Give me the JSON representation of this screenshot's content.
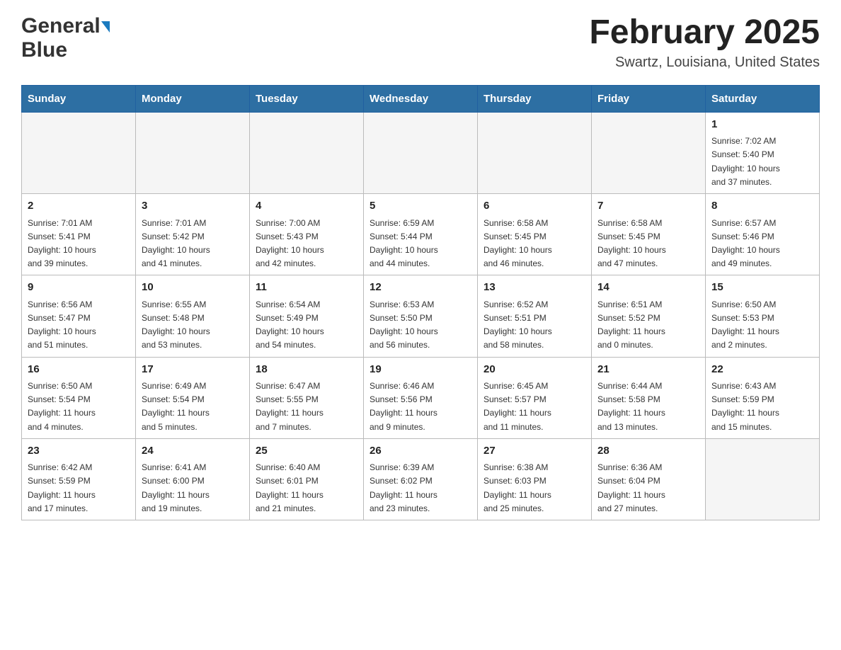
{
  "header": {
    "logo_general": "General",
    "logo_blue": "Blue",
    "month_year": "February 2025",
    "location": "Swartz, Louisiana, United States"
  },
  "weekdays": [
    "Sunday",
    "Monday",
    "Tuesday",
    "Wednesday",
    "Thursday",
    "Friday",
    "Saturday"
  ],
  "weeks": [
    [
      {
        "day": "",
        "info": ""
      },
      {
        "day": "",
        "info": ""
      },
      {
        "day": "",
        "info": ""
      },
      {
        "day": "",
        "info": ""
      },
      {
        "day": "",
        "info": ""
      },
      {
        "day": "",
        "info": ""
      },
      {
        "day": "1",
        "info": "Sunrise: 7:02 AM\nSunset: 5:40 PM\nDaylight: 10 hours\nand 37 minutes."
      }
    ],
    [
      {
        "day": "2",
        "info": "Sunrise: 7:01 AM\nSunset: 5:41 PM\nDaylight: 10 hours\nand 39 minutes."
      },
      {
        "day": "3",
        "info": "Sunrise: 7:01 AM\nSunset: 5:42 PM\nDaylight: 10 hours\nand 41 minutes."
      },
      {
        "day": "4",
        "info": "Sunrise: 7:00 AM\nSunset: 5:43 PM\nDaylight: 10 hours\nand 42 minutes."
      },
      {
        "day": "5",
        "info": "Sunrise: 6:59 AM\nSunset: 5:44 PM\nDaylight: 10 hours\nand 44 minutes."
      },
      {
        "day": "6",
        "info": "Sunrise: 6:58 AM\nSunset: 5:45 PM\nDaylight: 10 hours\nand 46 minutes."
      },
      {
        "day": "7",
        "info": "Sunrise: 6:58 AM\nSunset: 5:45 PM\nDaylight: 10 hours\nand 47 minutes."
      },
      {
        "day": "8",
        "info": "Sunrise: 6:57 AM\nSunset: 5:46 PM\nDaylight: 10 hours\nand 49 minutes."
      }
    ],
    [
      {
        "day": "9",
        "info": "Sunrise: 6:56 AM\nSunset: 5:47 PM\nDaylight: 10 hours\nand 51 minutes."
      },
      {
        "day": "10",
        "info": "Sunrise: 6:55 AM\nSunset: 5:48 PM\nDaylight: 10 hours\nand 53 minutes."
      },
      {
        "day": "11",
        "info": "Sunrise: 6:54 AM\nSunset: 5:49 PM\nDaylight: 10 hours\nand 54 minutes."
      },
      {
        "day": "12",
        "info": "Sunrise: 6:53 AM\nSunset: 5:50 PM\nDaylight: 10 hours\nand 56 minutes."
      },
      {
        "day": "13",
        "info": "Sunrise: 6:52 AM\nSunset: 5:51 PM\nDaylight: 10 hours\nand 58 minutes."
      },
      {
        "day": "14",
        "info": "Sunrise: 6:51 AM\nSunset: 5:52 PM\nDaylight: 11 hours\nand 0 minutes."
      },
      {
        "day": "15",
        "info": "Sunrise: 6:50 AM\nSunset: 5:53 PM\nDaylight: 11 hours\nand 2 minutes."
      }
    ],
    [
      {
        "day": "16",
        "info": "Sunrise: 6:50 AM\nSunset: 5:54 PM\nDaylight: 11 hours\nand 4 minutes."
      },
      {
        "day": "17",
        "info": "Sunrise: 6:49 AM\nSunset: 5:54 PM\nDaylight: 11 hours\nand 5 minutes."
      },
      {
        "day": "18",
        "info": "Sunrise: 6:47 AM\nSunset: 5:55 PM\nDaylight: 11 hours\nand 7 minutes."
      },
      {
        "day": "19",
        "info": "Sunrise: 6:46 AM\nSunset: 5:56 PM\nDaylight: 11 hours\nand 9 minutes."
      },
      {
        "day": "20",
        "info": "Sunrise: 6:45 AM\nSunset: 5:57 PM\nDaylight: 11 hours\nand 11 minutes."
      },
      {
        "day": "21",
        "info": "Sunrise: 6:44 AM\nSunset: 5:58 PM\nDaylight: 11 hours\nand 13 minutes."
      },
      {
        "day": "22",
        "info": "Sunrise: 6:43 AM\nSunset: 5:59 PM\nDaylight: 11 hours\nand 15 minutes."
      }
    ],
    [
      {
        "day": "23",
        "info": "Sunrise: 6:42 AM\nSunset: 5:59 PM\nDaylight: 11 hours\nand 17 minutes."
      },
      {
        "day": "24",
        "info": "Sunrise: 6:41 AM\nSunset: 6:00 PM\nDaylight: 11 hours\nand 19 minutes."
      },
      {
        "day": "25",
        "info": "Sunrise: 6:40 AM\nSunset: 6:01 PM\nDaylight: 11 hours\nand 21 minutes."
      },
      {
        "day": "26",
        "info": "Sunrise: 6:39 AM\nSunset: 6:02 PM\nDaylight: 11 hours\nand 23 minutes."
      },
      {
        "day": "27",
        "info": "Sunrise: 6:38 AM\nSunset: 6:03 PM\nDaylight: 11 hours\nand 25 minutes."
      },
      {
        "day": "28",
        "info": "Sunrise: 6:36 AM\nSunset: 6:04 PM\nDaylight: 11 hours\nand 27 minutes."
      },
      {
        "day": "",
        "info": ""
      }
    ]
  ]
}
